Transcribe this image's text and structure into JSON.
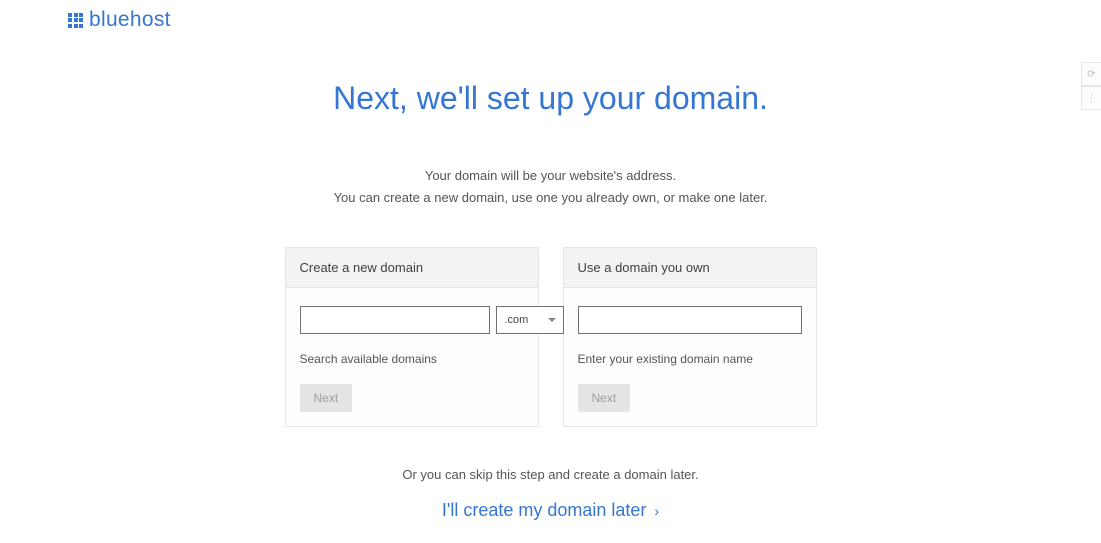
{
  "brand": {
    "name": "bluehost"
  },
  "page": {
    "title": "Next, we'll set up your domain.",
    "subtitle_line1": "Your domain will be your website's address.",
    "subtitle_line2": "You can create a new domain, use one you already own, or make one later."
  },
  "create_card": {
    "header": "Create a new domain",
    "tld_selected": ".com",
    "helper": "Search available domains",
    "next_label": "Next"
  },
  "own_card": {
    "header": "Use a domain you own",
    "helper": "Enter your existing domain name",
    "next_label": "Next"
  },
  "skip": {
    "lead": "Or you can skip this step and create a domain later.",
    "link": "I'll create my domain later"
  }
}
